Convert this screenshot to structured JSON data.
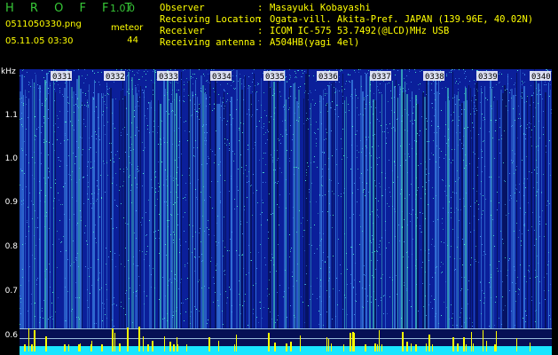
{
  "header": {
    "app_title": "H R O F F T",
    "version": "1.0.0",
    "file_name": "0511050330.png",
    "date_time": "05.11.05 03:30",
    "meteor_label": "meteor",
    "meteor_count": "44"
  },
  "info": [
    {
      "key": "Observer",
      "sep": ":",
      "value": "Masayuki Kobayashi"
    },
    {
      "key": "Receiving Location",
      "sep": ":",
      "value": "Ogata-vill. Akita-Pref. JAPAN (139.96E, 40.02N)"
    },
    {
      "key": "Receiver",
      "sep": ":",
      "value": "ICOM IC-575 53.7492(@LCD)MHz USB"
    },
    {
      "key": "Receiving antenna",
      "sep": ":",
      "value": "A504HB(yagi 4el)"
    }
  ],
  "spectrogram": {
    "y_unit": "kHz",
    "y_ticks": [
      "1.1",
      "1.0",
      "0.9",
      "0.8",
      "0.7",
      "0.6"
    ],
    "time_marks": [
      "0331",
      "0332",
      "0333",
      "0334",
      "0335",
      "0336",
      "0337",
      "0338",
      "0339",
      "0340"
    ],
    "colors": {
      "background": "#0b1f9a",
      "dark": "#06125a",
      "light": "#4ea8ff",
      "bright": "#54ffd0",
      "baseline": "#19e6ff",
      "line": "#bfe8ff",
      "marker_yellow": "#ffff00"
    }
  }
}
